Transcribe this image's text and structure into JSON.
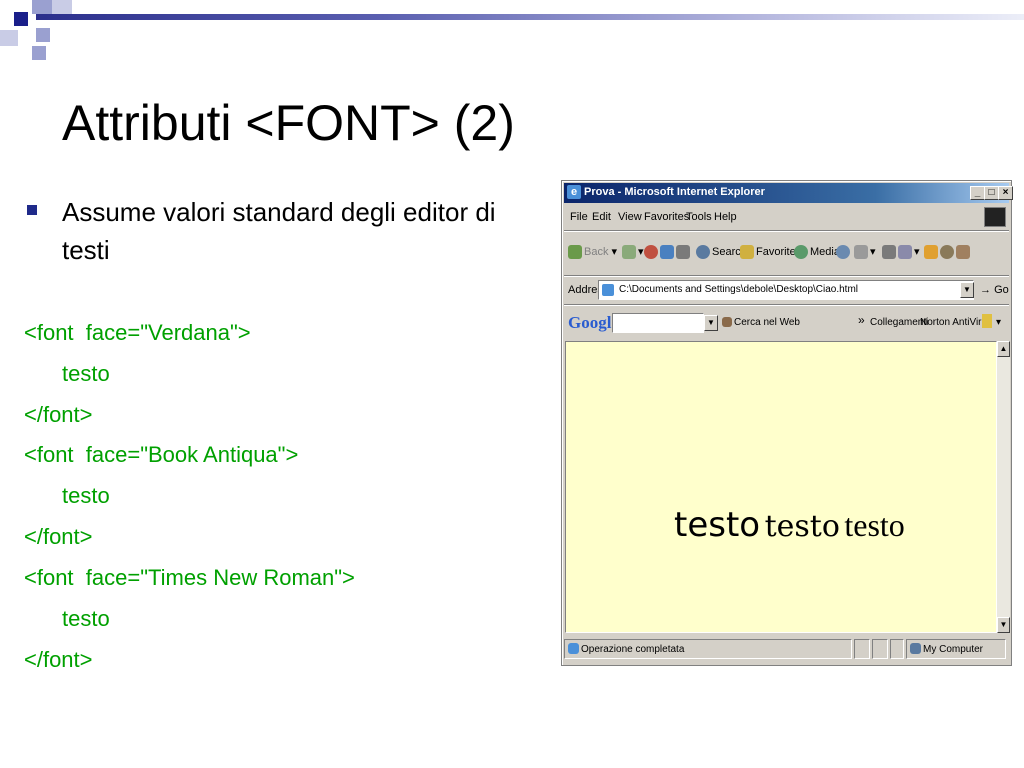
{
  "slide": {
    "title": "Attributi <FONT> (2)",
    "bullet": "Assume valori standard degli editor di testi",
    "code_lines": [
      "<font  face=\"Verdana\">",
      "testo",
      "</font>",
      "<font  face=\"Book Antiqua\">",
      "testo",
      "</font>",
      "<font  face=\"Times New Roman\">",
      "testo",
      "</font>"
    ]
  },
  "colors": {
    "code_text": "#00a000",
    "bullet": "#1f2a8a",
    "page_background": "#ffffcc",
    "ie_titlebar": "#0a246a"
  },
  "browser": {
    "title": "Prova - Microsoft Internet Explorer",
    "menu": [
      "File",
      "Edit",
      "View",
      "Favorites",
      "Tools",
      "Help"
    ],
    "toolbar": {
      "back": "Back",
      "search": "Search",
      "favorites": "Favorites",
      "media": "Media"
    },
    "address_label": "Address",
    "address_value": "C:\\Documents and Settings\\debole\\Desktop\\Ciao.html",
    "go_label": "Go",
    "google": {
      "logo": "Google",
      "search_web": "Cerca nel Web",
      "links": "Collegamenti",
      "norton": "Norton AntiVirus"
    },
    "content_samples": [
      "testo",
      "testo",
      "testo"
    ],
    "status_text": "Operazione completata",
    "zone": "My Computer"
  }
}
